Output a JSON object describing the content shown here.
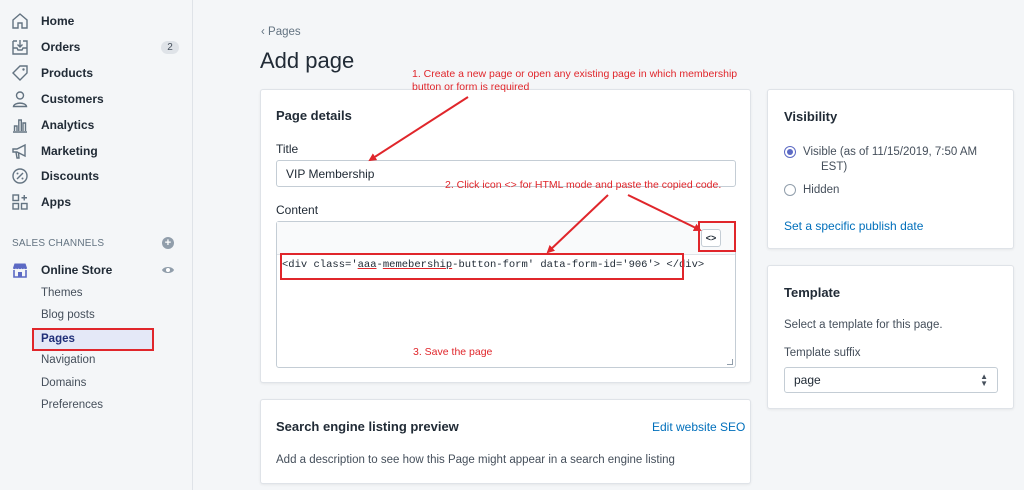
{
  "sidebar": {
    "items": [
      {
        "label": "Home",
        "icon": "home-icon"
      },
      {
        "label": "Orders",
        "icon": "orders-icon",
        "badge": "2"
      },
      {
        "label": "Products",
        "icon": "tag-icon"
      },
      {
        "label": "Customers",
        "icon": "user-icon"
      },
      {
        "label": "Analytics",
        "icon": "bar-chart-icon"
      },
      {
        "label": "Marketing",
        "icon": "megaphone-icon"
      },
      {
        "label": "Discounts",
        "icon": "discount-icon"
      },
      {
        "label": "Apps",
        "icon": "apps-icon"
      }
    ],
    "sales_channels_heading": "SALES CHANNELS",
    "online_store": "Online Store",
    "sub_items": [
      "Themes",
      "Blog posts",
      "Pages",
      "Navigation",
      "Domains",
      "Preferences"
    ]
  },
  "header": {
    "breadcrumb": "Pages",
    "title": "Add page"
  },
  "page_details": {
    "title": "Page details",
    "title_label": "Title",
    "title_value": "VIP Membership",
    "content_label": "Content",
    "code_button": "<>",
    "code_parts": [
      "<div class=",
      "'",
      "aaa",
      "-",
      "memebership",
      "-button-form' data-form-id='906'> </div>"
    ]
  },
  "annotations": {
    "step1": [
      "1. Create a new page or open any existing page in which membership",
      "button or form is required"
    ],
    "step2": "2. Click icon <> for HTML mode and paste the copied code.",
    "step3": "3. Save the page",
    "color": "#e0262b"
  },
  "seo": {
    "title": "Search engine listing preview",
    "edit_link": "Edit website SEO",
    "description": "Add a description to see how this Page might appear in a search engine listing"
  },
  "visibility": {
    "title": "Visibility",
    "visible_line1": "Visible (as of 11/15/2019, 7:50 AM",
    "visible_line2": "EST)",
    "hidden": "Hidden",
    "publish_link": "Set a specific publish date"
  },
  "template": {
    "title": "Template",
    "description": "Select a template for this page.",
    "suffix_label": "Template suffix",
    "suffix_value": "page"
  },
  "colors": {
    "accent": "#5c6ac4",
    "link": "#006fbb",
    "active_nav_text": "#202e78"
  }
}
